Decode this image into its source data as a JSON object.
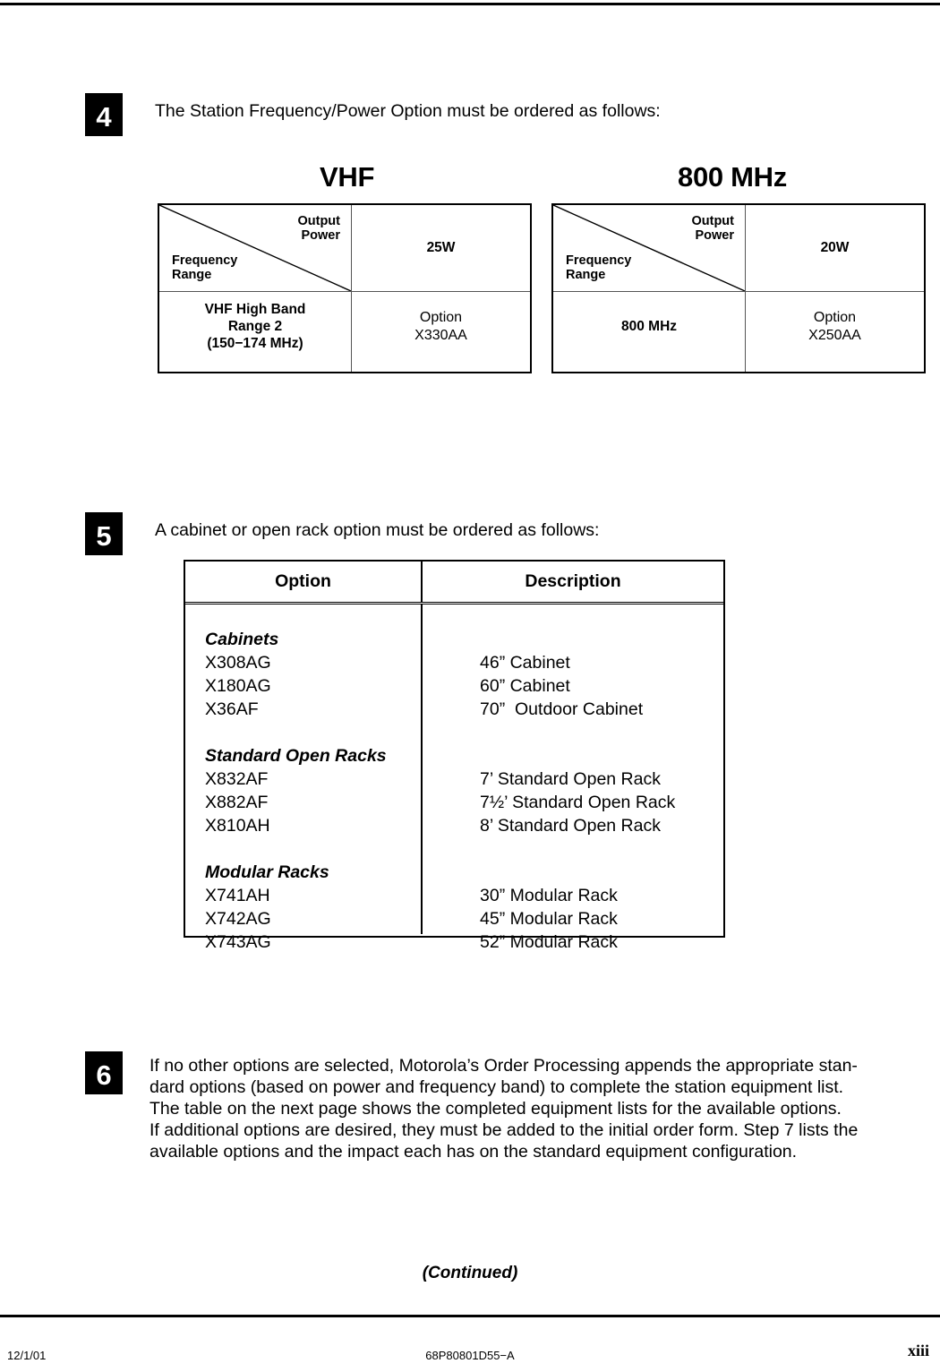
{
  "document": {
    "footer": {
      "date": "12/1/01",
      "part_number": "68P80801D55−A",
      "page_number": "xiii",
      "continued_label": "(Continued)"
    }
  },
  "steps": [
    {
      "number": "4",
      "text": "The Station Frequency/Power Option must be ordered as follows:"
    },
    {
      "number": "5",
      "text": "A cabinet or open rack option must be ordered as follows:"
    },
    {
      "number": "6",
      "text": "If no other options are selected, Motorola’s Order Processing appends the appropriate stan-\ndard options (based on power and frequency band) to complete the station equipment list.\nThe table on the next page shows the completed equipment lists for the available options.\nIf additional options are desired, they must be added to the initial order form. Step 7 lists the\navailable options and the impact each has on the standard equipment configuration."
    }
  ],
  "frequency_power_tables": [
    {
      "band_title": "VHF",
      "corner_output_label": "Output\nPower",
      "corner_frequency_label": "Frequency\nRange",
      "power_header": "25W",
      "range_label": "VHF High Band\nRange 2\n(150−174 MHz)",
      "option_value": "Option\nX330AA"
    },
    {
      "band_title": "800 MHz",
      "corner_output_label": "Output\nPower",
      "corner_frequency_label": "Frequency\nRange",
      "power_header": "20W",
      "range_label": "800 MHz",
      "option_value": "Option\nX250AA"
    }
  ],
  "option_table": {
    "headers": {
      "option": "Option",
      "description": "Description"
    },
    "groups": [
      {
        "title": "Cabinets",
        "rows": [
          {
            "option": "X308AG",
            "description": "46” Cabinet"
          },
          {
            "option": "X180AG",
            "description": "60” Cabinet"
          },
          {
            "option": "X36AF",
            "description": "70”  Outdoor Cabinet"
          }
        ]
      },
      {
        "title": "Standard Open Racks",
        "rows": [
          {
            "option": "X832AF",
            "description": "7’ Standard Open Rack"
          },
          {
            "option": "X882AF",
            "description": "7½’ Standard Open Rack"
          },
          {
            "option": "X810AH",
            "description": "8’ Standard Open Rack"
          }
        ]
      },
      {
        "title": "Modular Racks",
        "rows": [
          {
            "option": "X741AH",
            "description": "30” Modular Rack"
          },
          {
            "option": "X742AG",
            "description": "45” Modular Rack"
          },
          {
            "option": "X743AG",
            "description": "52” Modular Rack"
          }
        ]
      }
    ]
  }
}
